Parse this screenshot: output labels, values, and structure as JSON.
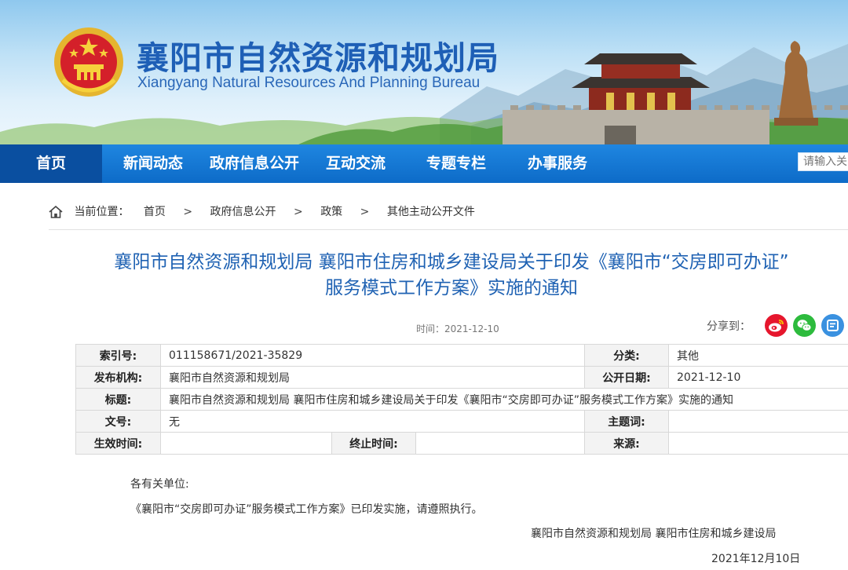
{
  "header": {
    "title": "襄阳市自然资源和规划局",
    "subtitle": "Xiangyang Natural Resources And Planning Bureau"
  },
  "nav": {
    "items": [
      {
        "label": "首页",
        "active": true
      },
      {
        "label": "新闻动态"
      },
      {
        "label": "政府信息公开"
      },
      {
        "label": "互动交流"
      },
      {
        "label": "专题专栏"
      },
      {
        "label": "办事服务"
      }
    ],
    "search_placeholder": "请输入关键字"
  },
  "breadcrumb": {
    "prefix": "当前位置：",
    "items": [
      "首页",
      "政府信息公开",
      "政策",
      "其他主动公开文件"
    ],
    "separator": ">"
  },
  "article": {
    "title_line1": "襄阳市自然资源和规划局 襄阳市住房和城乡建设局关于印发《襄阳市“交房即可办证”",
    "title_line2": "服务模式工作方案》实施的通知",
    "time_label": "时间：",
    "time": "2021-12-10",
    "share_label": "分享到：",
    "share_icons": [
      "weibo-icon",
      "wechat-icon",
      "qzone-icon"
    ],
    "share_colors": [
      "#e6162d",
      "#2dbb3d",
      "#3a91e0"
    ]
  },
  "meta": {
    "index_label": "索引号:",
    "index_value": "011158671/2021-35829",
    "category_label": "分类:",
    "category_value": "其他",
    "publisher_label": "发布机构:",
    "publisher_value": "襄阳市自然资源和规划局",
    "date_label": "公开日期:",
    "date_value": "2021-12-10",
    "title_label": "标题:",
    "title_value": "襄阳市自然资源和规划局 襄阳市住房和城乡建设局关于印发《襄阳市“交房即可办证”服务模式工作方案》实施的通知",
    "docno_label": "文号:",
    "docno_value": "无",
    "keyword_label": "主题词:",
    "keyword_value": "",
    "effective_label": "生效时间:",
    "effective_value": "",
    "end_label": "终止时间:",
    "end_value": "",
    "source_label": "来源:",
    "source_value": ""
  },
  "body": {
    "greeting": "各有关单位:",
    "paragraph": "《襄阳市“交房即可办证”服务模式工作方案》已印发实施，请遵照执行。",
    "signature": "襄阳市自然资源和规划局 襄阳市住房和城乡建设局",
    "date": "2021年12月10日"
  },
  "colors": {
    "brand_blue": "#1e5fb6",
    "nav_blue": "#0d6bc8",
    "nav_active": "#0a4fa0",
    "title_blue": "#1f62b3"
  }
}
